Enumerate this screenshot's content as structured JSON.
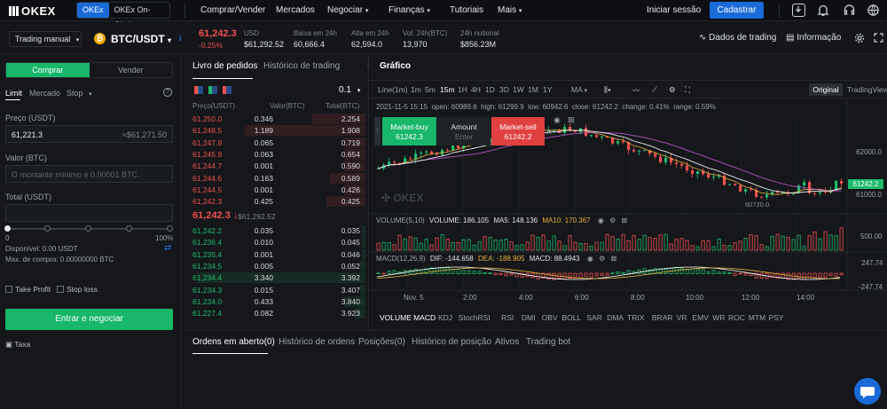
{
  "nav": {
    "logo": "OKEX",
    "toggle": [
      "OKEx",
      "OKEx On-Chain"
    ],
    "items": [
      "Comprar/Vender",
      "Mercados",
      "Negociar",
      "Finanças",
      "Tutoriais",
      "Mais"
    ],
    "login": "Iniciar sessão",
    "signup": "Cadastrar"
  },
  "ticker": {
    "mode": "Trading manual",
    "pair": "BTC/USDT",
    "price": "61,242.3",
    "change": "-0.25%",
    "usd_label": "USD",
    "usd_value": "$61,292.52",
    "low_label": "Baixa em 24h",
    "low_value": "60,666.4",
    "high_label": "Alta em 24h",
    "high_value": "62,594.0",
    "vol_label": "Vol. 24h(BTC)",
    "vol_value": "13,970",
    "notional_label": "24h notional",
    "notional_value": "$856.23M",
    "trading_data": "Dados de trading",
    "info": "Informação"
  },
  "trade": {
    "buy_tab": "Comprar",
    "sell_tab": "Vender",
    "types": [
      "Limit",
      "Mercado",
      "Stop"
    ],
    "price_label": "Preço (USDT)",
    "price_value": "61,221.3",
    "price_hint": "≈$61,271.50",
    "value_label": "Valor (BTC)",
    "value_placeholder": "O montante mínimo é 0.00001 BTC.",
    "total_label": "Total (USDT)",
    "slider_min": "0",
    "slider_max": "100%",
    "available": "Disponível: 0.00 USDT",
    "max_buy": "Max. de compra: 0.00000000 BTC",
    "take_profit": "Take Profit",
    "stop_loss": "Stop loss",
    "submit": "Entrar e negociar",
    "fee": "Taxa"
  },
  "book": {
    "tab_orders": "Livro de pedidos",
    "tab_history": "Histórico de trading",
    "precision": "0.1",
    "col_price": "Preço(USDT)",
    "col_value": "Valor(BTC)",
    "col_total": "Total(BTC)",
    "asks": [
      {
        "p": "61,250.0",
        "v": "0.346",
        "t": "2.254",
        "d": 0.3
      },
      {
        "p": "61,248.5",
        "v": "1.189",
        "t": "1.908",
        "d": 0.68
      },
      {
        "p": "61,247.9",
        "v": "0.065",
        "t": "0.719",
        "d": 0.12
      },
      {
        "p": "61,245.9",
        "v": "0.063",
        "t": "0.654",
        "d": 0.12
      },
      {
        "p": "61,244.7",
        "v": "0.001",
        "t": "0.590",
        "d": 0.12
      },
      {
        "p": "61,244.6",
        "v": "0.163",
        "t": "0.589",
        "d": 0.2
      },
      {
        "p": "61,244.5",
        "v": "0.001",
        "t": "0.426",
        "d": 0.12
      },
      {
        "p": "61,242.3",
        "v": "0.425",
        "t": "0.425",
        "d": 0.22
      }
    ],
    "last_price": "61,242.3",
    "last_usd": "$61,292.52",
    "bids": [
      {
        "p": "61,242.2",
        "v": "0.035",
        "t": "0.035",
        "d": 0.02
      },
      {
        "p": "61,236.4",
        "v": "0.010",
        "t": "0.045",
        "d": 0.02
      },
      {
        "p": "61,235.4",
        "v": "0.001",
        "t": "0.046",
        "d": 0.02
      },
      {
        "p": "61,234.5",
        "v": "0.005",
        "t": "0.052",
        "d": 0.03
      },
      {
        "p": "61,234.4",
        "v": "3.340",
        "t": "3.392",
        "d": 0.95
      },
      {
        "p": "61,234.3",
        "v": "0.015",
        "t": "3.407",
        "d": 0.03
      },
      {
        "p": "61,234.0",
        "v": "0.433",
        "t": "3.840",
        "d": 0.12
      },
      {
        "p": "61,227.4",
        "v": "0.082",
        "t": "3.923",
        "d": 0.06
      }
    ]
  },
  "chart": {
    "title": "Gráfico",
    "intervals": [
      "Line(1m)",
      "1m",
      "5m",
      "15m",
      "1H",
      "4H",
      "1D",
      "3D",
      "1W",
      "1M",
      "1Y"
    ],
    "active_interval": "15m",
    "ma": "MA",
    "view_original": "Original",
    "view_tv": "TradingView",
    "ohlc": "2021-11-5 15:15  open: 60989.6  high: 61299.9  low: 60942.6  close: 61242.2  change: 0.41%  range: 0.59%",
    "quick": {
      "buy": "Market-buy",
      "buy_price": "61242.3",
      "amount": "Amount",
      "enter": "Enter",
      "sell": "Market-sell",
      "sell_price": "61242.2"
    },
    "price_axis": [
      "62000.0",
      "61000.0"
    ],
    "current_price": "61242.2",
    "low_marker": "60720.0",
    "volume_legend": {
      "label": "VOLUME(5,10)",
      "volume": "VOLUME: 186.105",
      "ma5": "MA5: 148.136",
      "ma10": "MA10: 170.367"
    },
    "volume_axis": "500.00",
    "macd_legend": {
      "label": "MACD(12,26,9)",
      "dif": "DIF: -144.658",
      "dea": "DEA: -188.905",
      "macd": "MACD: 88.4943"
    },
    "macd_axis": [
      "247.74",
      "-247.74"
    ],
    "time_axis": [
      "Nov. 5",
      "2:00",
      "4:00",
      "6:00",
      "8:00",
      "10:00",
      "12:00",
      "14:00"
    ],
    "indicators": [
      "VOLUME",
      "MACD",
      "KDJ",
      "StochRSI",
      "RSI",
      "DMI",
      "OBV",
      "BOLL",
      "SAR",
      "DMA",
      "TRIX",
      "BRAR",
      "VR",
      "EMV",
      "WR",
      "ROC",
      "MTM",
      "PSY"
    ],
    "colors": {
      "up": "#1ebb6c",
      "down": "#f0504f",
      "ma_fast": "#e8b33c",
      "ma_slow": "#c75ad6",
      "accent": "#1a6bd8"
    }
  },
  "orders": {
    "tabs": [
      "Ordens em aberto(0)",
      "Histórico de ordens",
      "Posições(0)",
      "Histórico de posição",
      "Ativos",
      "Trading bot"
    ]
  }
}
